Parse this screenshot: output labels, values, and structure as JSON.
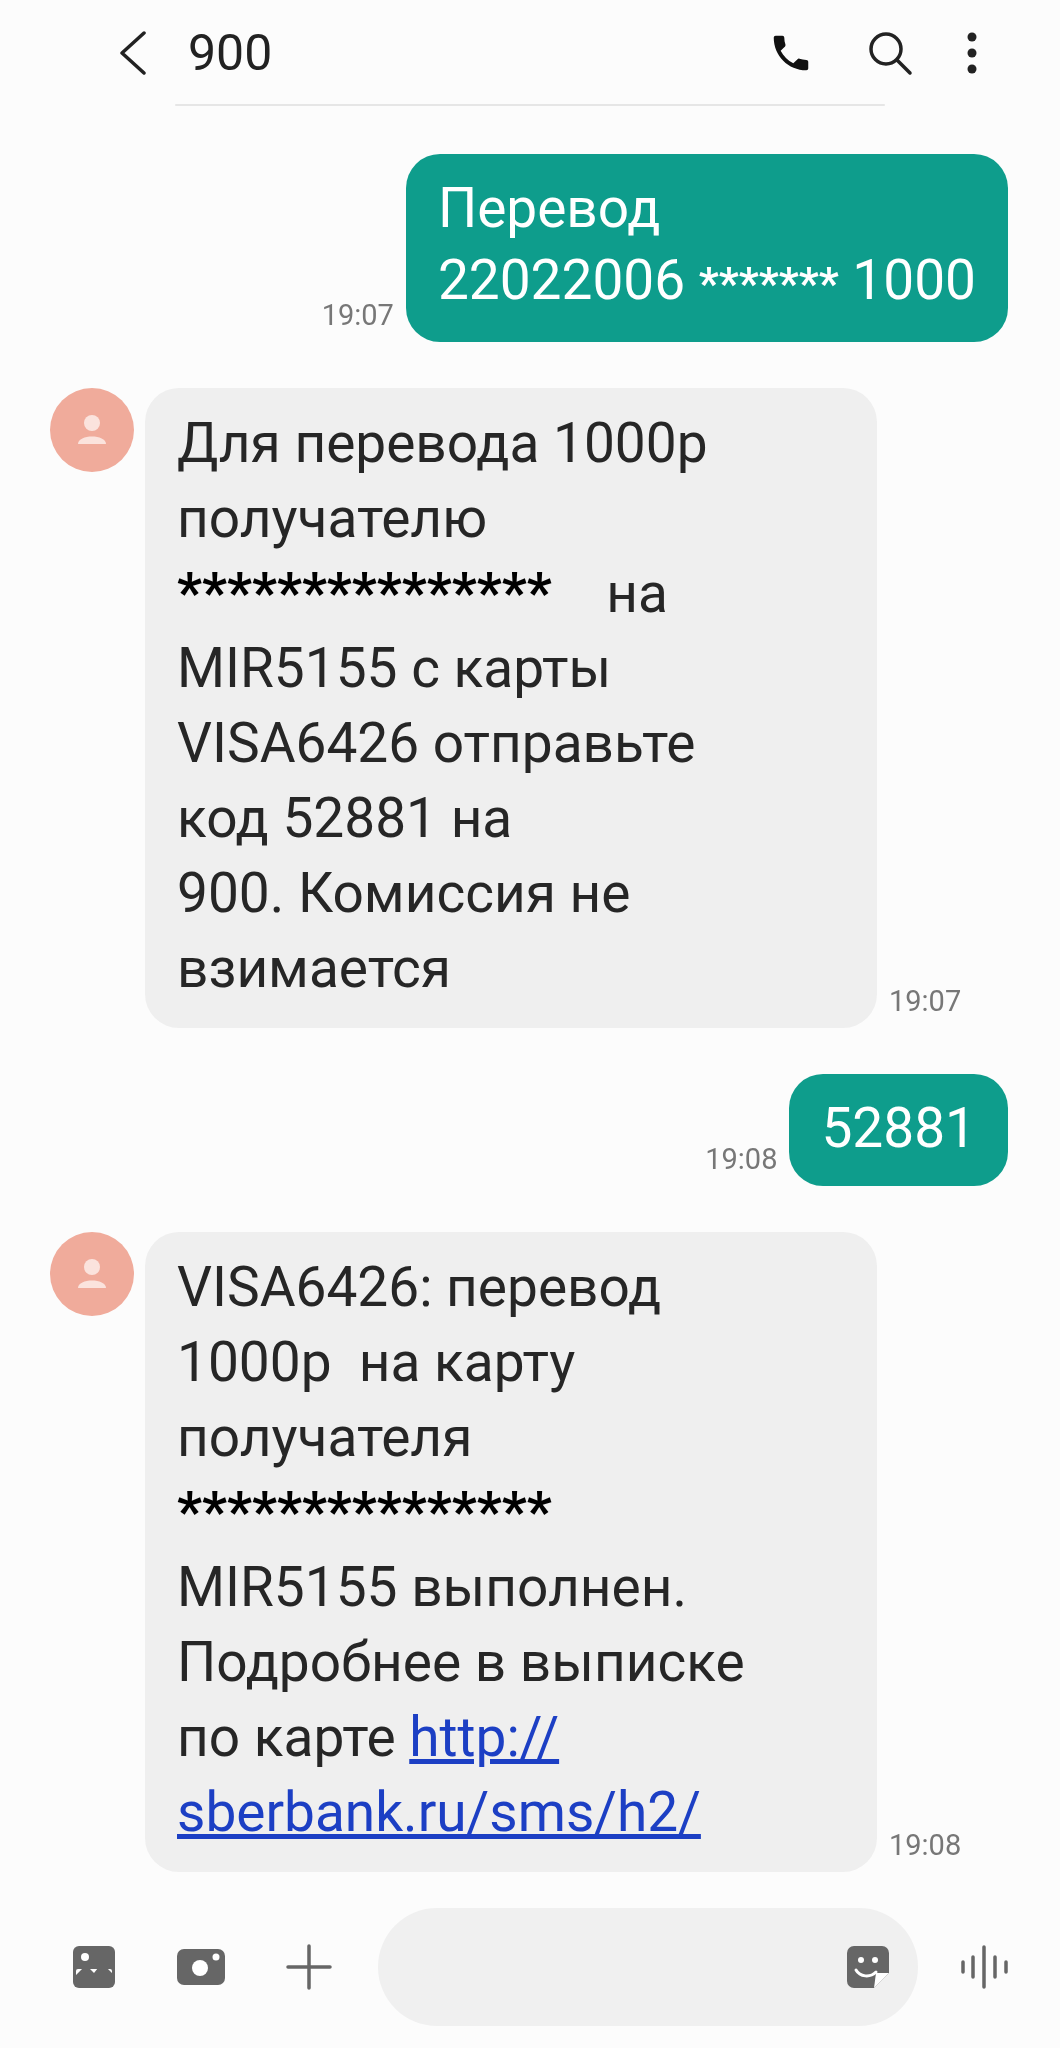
{
  "header": {
    "title": "900"
  },
  "messages": [
    {
      "kind": "sent",
      "time": "19:07",
      "lines": [
        [
          {
            "kind": "text",
            "text": "Перевод"
          }
        ],
        [
          {
            "kind": "text",
            "text": "22022006 "
          },
          {
            "kind": "mask",
            "text": "*******"
          },
          {
            "kind": "text",
            "text": " 1000"
          }
        ]
      ]
    },
    {
      "kind": "received",
      "time": "19:07",
      "lines": [
        [
          {
            "kind": "text",
            "text": "Для перевода 1000р"
          }
        ],
        [
          {
            "kind": "text",
            "text": "получателю"
          }
        ],
        [
          {
            "kind": "mask",
            "text": "***************"
          },
          {
            "kind": "text",
            "text": "    на"
          }
        ],
        [
          {
            "kind": "text",
            "text": "MIR5155 с карты"
          }
        ],
        [
          {
            "kind": "text",
            "text": "VISA6426 отправьте"
          }
        ],
        [
          {
            "kind": "text",
            "text": "код 52881 на"
          }
        ],
        [
          {
            "kind": "text",
            "text": "900. Комиссия не"
          }
        ],
        [
          {
            "kind": "text",
            "text": "взимается"
          }
        ]
      ]
    },
    {
      "kind": "sent",
      "time": "19:08",
      "lines": [
        [
          {
            "kind": "text",
            "text": "52881"
          }
        ]
      ]
    },
    {
      "kind": "received",
      "time": "19:08",
      "lines": [
        [
          {
            "kind": "text",
            "text": "VISA6426: перевод"
          }
        ],
        [
          {
            "kind": "text",
            "text": "1000р  на карту"
          }
        ],
        [
          {
            "kind": "text",
            "text": "получателя"
          }
        ],
        [
          {
            "kind": "mask",
            "text": "***************"
          }
        ],
        [
          {
            "kind": "text",
            "text": "MIR5155 выполнен."
          }
        ],
        [
          {
            "kind": "text",
            "text": "Подробнее в выписке"
          }
        ],
        [
          {
            "kind": "text",
            "text": "по карте "
          },
          {
            "kind": "link",
            "text": "http://"
          }
        ],
        [
          {
            "kind": "link",
            "text": "sberbank.ru/sms/h2/"
          }
        ]
      ]
    }
  ]
}
